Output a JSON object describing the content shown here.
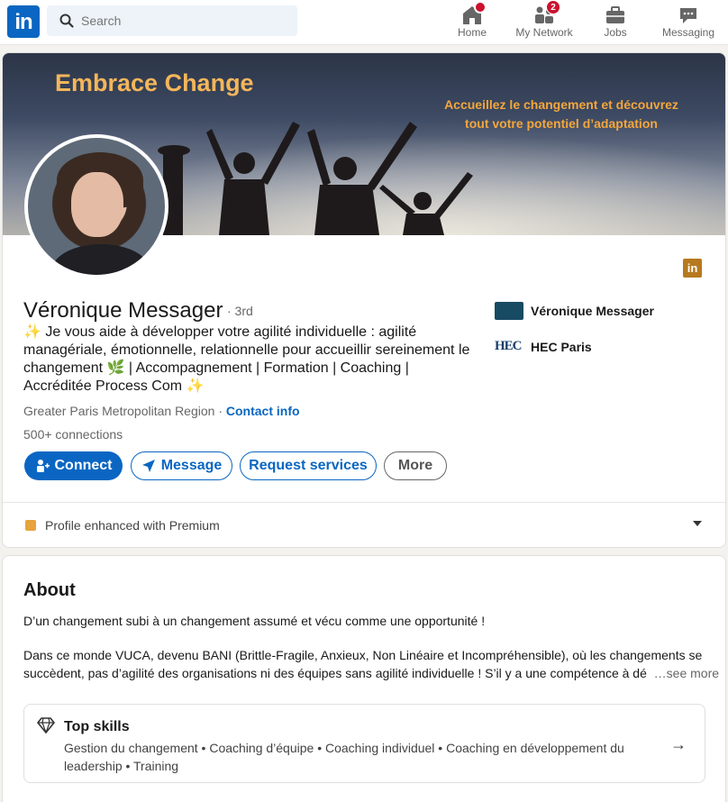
{
  "nav": {
    "logo_text": "in",
    "search_placeholder": "Search",
    "items": [
      {
        "label": "Home",
        "icon": "home-icon",
        "badge": ""
      },
      {
        "label": "My Network",
        "icon": "network-icon",
        "badge": "2"
      },
      {
        "label": "Jobs",
        "icon": "briefcase-icon",
        "badge": ""
      },
      {
        "label": "Messaging",
        "icon": "messaging-icon",
        "badge": ""
      }
    ]
  },
  "banner": {
    "title": "Embrace Change",
    "subtitle_line1": "Accueillez le changement et découvrez",
    "subtitle_line2": "tout votre potentiel d’adaptation"
  },
  "profile": {
    "name": "Véronique Messager",
    "degree": "· 3rd",
    "headline": "✨ Je vous aide à développer votre agilité individuelle : agilité managériale, émotionnelle, relationnelle pour accueillir sereinement le changement 🌿 | Accompagnement | Formation | Coaching | Accréditée Process Com ✨",
    "location": "Greater Paris Metropolitan Region",
    "location_sep": " · ",
    "contact_info": "Contact info",
    "connections": "500+ connections",
    "current_company": "Véronique Messager",
    "education": "HEC Paris",
    "linkedin_badge": "in"
  },
  "actions": {
    "connect": "Connect",
    "message": "Message",
    "request_services": "Request services",
    "more": "More"
  },
  "premium": {
    "text": "Profile enhanced with Premium"
  },
  "about": {
    "title": "About",
    "line1": "D’un changement subi à un changement assumé et vécu comme une opportunité !",
    "line2": "Dans ce monde VUCA, devenu BANI (Brittle-Fragile, Anxieux, Non Linéaire et Incompréhensible), où les changements se",
    "line3": "succèdent, pas d’agilité des organisations ni des équipes sans agilité individuelle ! S’il y a une compétence à dé",
    "see_more": "…see more",
    "top_skills_title": "Top skills",
    "top_skills_text": "Gestion du changement • Coaching d’équipe • Coaching individuel • Coaching en développement du leadership • Training"
  },
  "colors": {
    "brand": "#0a66c2",
    "banner_title": "#f4b65a",
    "premium": "#e7a33e"
  }
}
